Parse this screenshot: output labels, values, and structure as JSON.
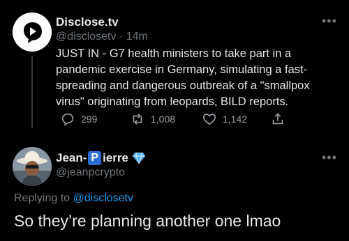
{
  "tweet1": {
    "name": "Disclose.tv",
    "handle": "@disclosetv",
    "separator": "·",
    "time": "14m",
    "text_lines": [
      "JUST IN - G7 health ministers to take part in a",
      "pandemic exercise in Germany, simulating a fast-",
      "spreading and dangerous outbreak of a \"smallpox",
      "virus\" originating from leopards, BILD reports."
    ],
    "actions": {
      "replies": "299",
      "retweets": "1,008",
      "likes": "1,142"
    },
    "more_icon": "more-icon"
  },
  "tweet2": {
    "name_prefix": "Jean-",
    "name_badge_letter": "P",
    "name_suffix": "ierre",
    "handle": "@jeanpcrypto",
    "replying_label": "Replying to",
    "replying_handle": "@disclosetv",
    "text": "So they’re planning another one lmao",
    "more_icon": "more-icon"
  },
  "colors": {
    "background": "#000000",
    "text": "#e7e9ea",
    "muted": "#71767b",
    "link": "#1d9bf0",
    "diamond": "#5ab6ff"
  }
}
